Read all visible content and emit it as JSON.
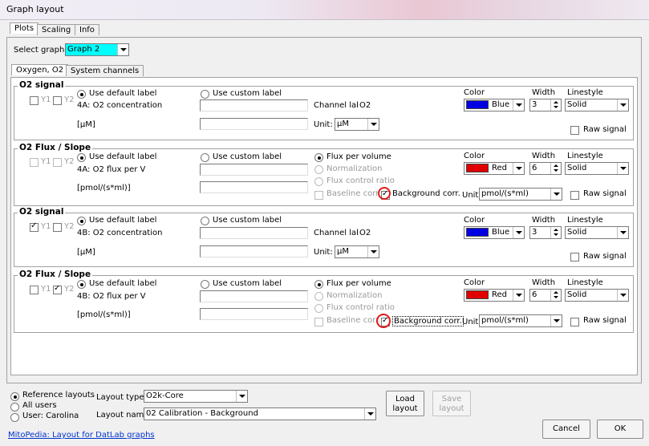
{
  "window": {
    "title": "Graph layout"
  },
  "top_tabs": [
    "Plots",
    "Scaling",
    "Info"
  ],
  "select_graph": {
    "label": "Select graph",
    "value": "Graph 2"
  },
  "sub_tabs": [
    "Oxygen, O2",
    "System channels"
  ],
  "common": {
    "use_default_label": "Use default label",
    "use_custom_label": "Use custom label",
    "y1": "Y1",
    "y2": "Y2",
    "color": "Color",
    "width": "Width",
    "linestyle": "Linestyle",
    "raw_signal": "Raw signal",
    "channel_label": "Channel label:",
    "unit": "Unit:",
    "unit_flux": "Unit",
    "flux_per_volume": "Flux per volume",
    "normalization": "Normalization",
    "flux_control_ratio": "Flux control ratio",
    "baseline_corr": "Baseline corr.",
    "background_corr": "Background corr."
  },
  "groups": [
    {
      "title": "O2 signal",
      "y1": false,
      "y2": false,
      "default_label": "4A: O2 concentration",
      "unit_label": "[µM]",
      "channel_value": "O2",
      "unit_value": "µM",
      "color_name": "Blue",
      "color_hex": "#0000e0",
      "width": "3",
      "linestyle": "Solid",
      "raw": false
    },
    {
      "title": "O2 Flux / Slope",
      "y1": false,
      "y2": false,
      "default_label": "4A: O2 flux per V",
      "unit_label": "[pmol/(s*ml)]",
      "unit_value": "pmol/(s*ml)",
      "color_name": "Red",
      "color_hex": "#e00000",
      "width": "6",
      "linestyle": "Solid",
      "raw": false,
      "baseline": false,
      "background": true
    },
    {
      "title": "O2 signal",
      "y1": true,
      "y2": false,
      "default_label": "4B: O2 concentration",
      "unit_label": "[µM]",
      "channel_value": "O2",
      "unit_value": "µM",
      "color_name": "Blue",
      "color_hex": "#0000e0",
      "width": "3",
      "linestyle": "Solid",
      "raw": false
    },
    {
      "title": "O2 Flux / Slope",
      "y1": false,
      "y2": true,
      "default_label": "4B: O2 flux per V",
      "unit_label": "[pmol/(s*ml)]",
      "unit_value": "pmol/(s*ml)",
      "color_name": "Red",
      "color_hex": "#e00000",
      "width": "6",
      "linestyle": "Solid",
      "raw": false,
      "baseline": false,
      "background": true
    }
  ],
  "bottom": {
    "radios": [
      "Reference layouts",
      "All users",
      "User: Carolina"
    ],
    "layout_type_label": "Layout type",
    "layout_type_value": "O2k-Core",
    "layout_name_label": "Layout name",
    "layout_name_value": "02 Calibration - Background",
    "load_button": "Load\nlayout",
    "save_button": "Save\nlayout",
    "link": "MitoPedia: Layout for DatLab graphs",
    "cancel": "Cancel",
    "ok": "OK"
  },
  "accent_colors": {
    "highlight": "#00ffff",
    "annotation": "#e21b1b"
  }
}
